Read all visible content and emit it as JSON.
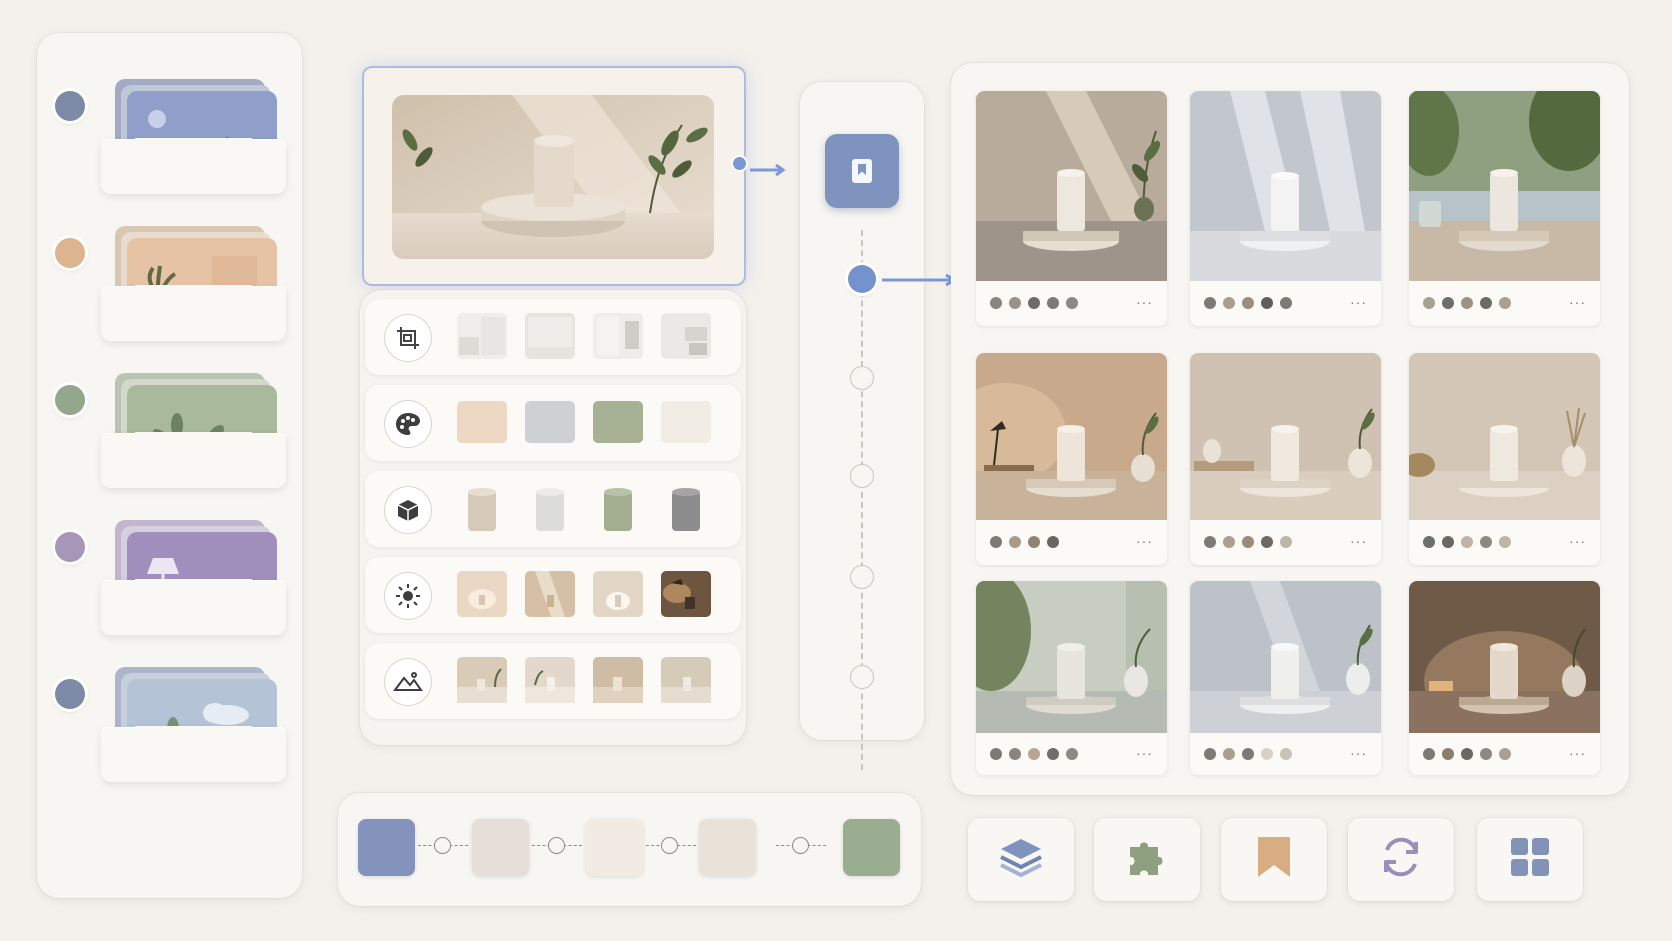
{
  "app": {
    "colors": {
      "accent": "#7592cf",
      "background": "#f4f1ec"
    }
  },
  "left_trays": [
    {
      "dot_color": "#7c8aa6",
      "theme": "landscape",
      "icon": "image-icon"
    },
    {
      "dot_color": "#dcb48f",
      "theme": "interior",
      "icon": "plant-icon"
    },
    {
      "dot_color": "#93a78c",
      "theme": "foliage",
      "icon": "leaf-icon"
    },
    {
      "dot_color": "#a896b9",
      "theme": "lamp",
      "icon": "lamp-icon"
    },
    {
      "dot_color": "#7c8aa6",
      "theme": "sky",
      "icon": "cloud-icon"
    }
  ],
  "option_rows": [
    {
      "icon": "crop-icon",
      "kind": "layout"
    },
    {
      "icon": "palette-icon",
      "kind": "color",
      "swatches": [
        "#ecd8c3",
        "#cfd0d4",
        "#a7b194",
        "#f1ece4"
      ]
    },
    {
      "icon": "cube-icon",
      "kind": "material",
      "cylinders": [
        "#d6c9b8",
        "#dcdcdb",
        "#a4af92",
        "#8c8d8c"
      ]
    },
    {
      "icon": "sun-icon",
      "kind": "lighting"
    },
    {
      "icon": "mountain-icon",
      "kind": "scene"
    }
  ],
  "gallery": [
    {
      "dots": [
        "#8a8580",
        "#9a928a",
        "#6d6a68",
        "#7d7a76",
        "#8d8883"
      ],
      "more": "···"
    },
    {
      "dots": [
        "#7d7a76",
        "#a99e92",
        "#988d82",
        "#5f5e5e",
        "#7d7a76"
      ],
      "more": "···"
    },
    {
      "dots": [
        "#a8a095",
        "#6d6f6a",
        "#9a9386",
        "#6b6b65",
        "#a8a095"
      ],
      "more": "···"
    },
    {
      "dots": [
        "#7d7a76",
        "#a99a8a",
        "#8e8475",
        "#6a6662"
      ],
      "more": "···"
    },
    {
      "dots": [
        "#7d7a76",
        "#a99e92",
        "#998b7b",
        "#6e6862",
        "#bfb6aa"
      ],
      "more": "···"
    },
    {
      "dots": [
        "#6d6f6a",
        "#6a6662",
        "#bdb3a6",
        "#8c8983",
        "#bdb6ab"
      ],
      "more": "···"
    },
    {
      "dots": [
        "#7d7a76",
        "#8b847d",
        "#b6a792",
        "#6d6f6a",
        "#8c8983"
      ],
      "more": "···"
    },
    {
      "dots": [
        "#7d7a76",
        "#a99e92",
        "#7d7a76",
        "#d7d1c8",
        "#cac3b8"
      ],
      "more": "···"
    },
    {
      "dots": [
        "#7d7a76",
        "#8b7d6d",
        "#6a6662",
        "#8c8983",
        "#a8a095"
      ],
      "more": "···"
    }
  ],
  "palette": [
    "#8493bc",
    "#e6dfd9",
    "#f1ebe4",
    "#e9e2d8",
    "#9aad90"
  ],
  "tools": [
    {
      "icon": "layers-icon"
    },
    {
      "icon": "puzzle-icon"
    },
    {
      "icon": "bookmark-icon"
    },
    {
      "icon": "refresh-icon"
    },
    {
      "icon": "grid-icon"
    }
  ]
}
